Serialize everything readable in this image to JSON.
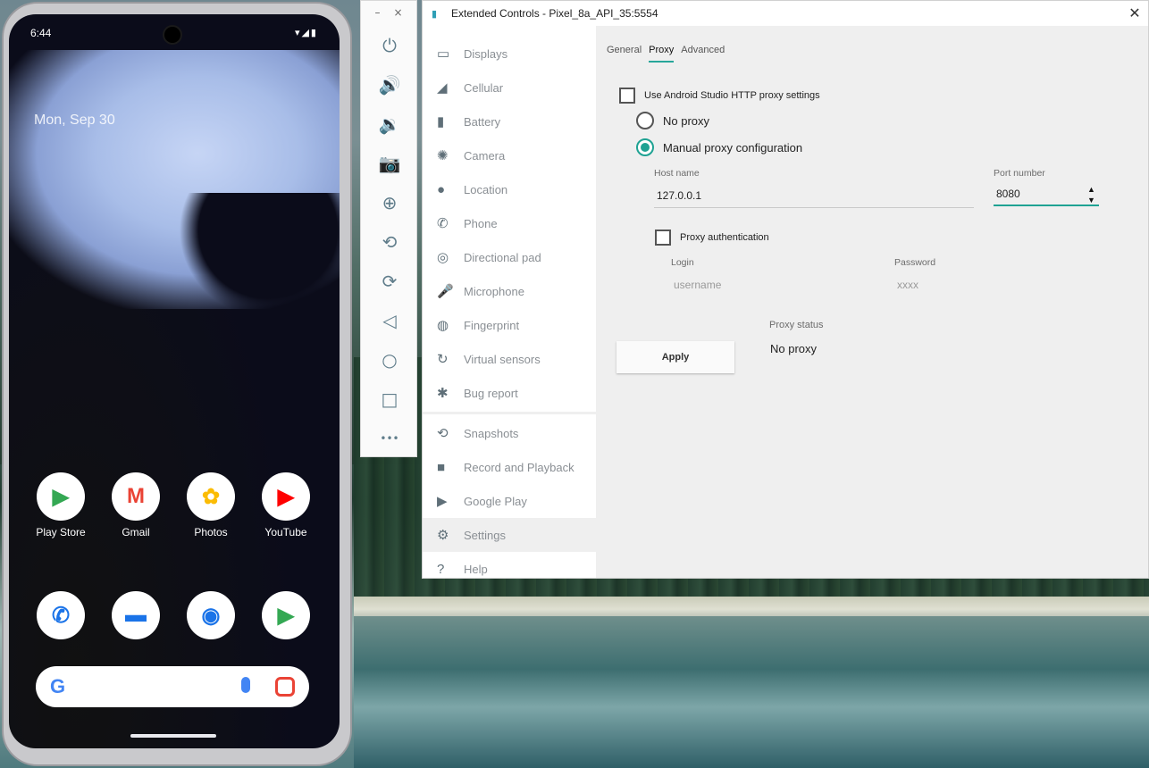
{
  "phone": {
    "time": "6:44",
    "status_icons": "▾◢▮",
    "date": "Mon, Sep 30",
    "apps_row1": [
      {
        "label": "Play Store",
        "icon": "play-store-icon",
        "glyph": "▶",
        "color": "#34a853"
      },
      {
        "label": "Gmail",
        "icon": "gmail-icon",
        "glyph": "M",
        "color": "#ea4335"
      },
      {
        "label": "Photos",
        "icon": "photos-icon",
        "glyph": "✿",
        "color": "#fbbc04"
      },
      {
        "label": "YouTube",
        "icon": "youtube-icon",
        "glyph": "▶",
        "color": "#ff0000"
      }
    ],
    "apps_row2": [
      {
        "icon": "phone-icon",
        "glyph": "✆",
        "color": "#1a73e8"
      },
      {
        "icon": "messages-icon",
        "glyph": "▬",
        "color": "#1a73e8"
      },
      {
        "icon": "chrome-icon",
        "glyph": "◉",
        "color": "#1a73e8"
      },
      {
        "icon": "play-store-2-icon",
        "glyph": "▶",
        "color": "#34a853"
      }
    ],
    "search_g": "G"
  },
  "toolbar": {
    "minimize": "–",
    "close": "×",
    "buttons": [
      {
        "name": "power-icon",
        "glyph": "⏻"
      },
      {
        "name": "volume-up-icon",
        "glyph": "🔊"
      },
      {
        "name": "volume-down-icon",
        "glyph": "🔉"
      },
      {
        "name": "camera-icon",
        "glyph": "📷"
      },
      {
        "name": "zoom-icon",
        "glyph": "⊕"
      },
      {
        "name": "rotate-left-icon",
        "glyph": "⟲"
      },
      {
        "name": "rotate-right-icon",
        "glyph": "⟳"
      },
      {
        "name": "back-icon",
        "glyph": "◁"
      },
      {
        "name": "home-icon",
        "glyph": "○"
      },
      {
        "name": "overview-icon",
        "glyph": "□"
      },
      {
        "name": "more-icon",
        "glyph": "•••"
      }
    ]
  },
  "window": {
    "title": "Extended Controls - Pixel_8a_API_35:5554",
    "close": "✕"
  },
  "nav": {
    "items": [
      {
        "label": "Displays",
        "glyph": "▭"
      },
      {
        "label": "Cellular",
        "glyph": "◢"
      },
      {
        "label": "Battery",
        "glyph": "▮"
      },
      {
        "label": "Camera",
        "glyph": "✺"
      },
      {
        "label": "Location",
        "glyph": "●"
      },
      {
        "label": "Phone",
        "glyph": "✆"
      },
      {
        "label": "Directional pad",
        "glyph": "◎"
      },
      {
        "label": "Microphone",
        "glyph": "🎤"
      },
      {
        "label": "Fingerprint",
        "glyph": "◍"
      },
      {
        "label": "Virtual sensors",
        "glyph": "↻"
      },
      {
        "label": "Bug report",
        "glyph": "✱"
      }
    ],
    "items2": [
      {
        "label": "Snapshots",
        "glyph": "⟲"
      },
      {
        "label": "Record and Playback",
        "glyph": "■"
      },
      {
        "label": "Google Play",
        "glyph": "▶"
      },
      {
        "label": "Settings",
        "glyph": "⚙",
        "active": true
      },
      {
        "label": "Help",
        "glyph": "?"
      }
    ]
  },
  "tabs": [
    "General",
    "Proxy",
    "Advanced"
  ],
  "proxy": {
    "use_studio": "Use Android Studio HTTP proxy settings",
    "no_proxy": "No proxy",
    "manual": "Manual proxy configuration",
    "host_label": "Host name",
    "host_value": "127.0.0.1",
    "port_label": "Port number",
    "port_value": "8080",
    "auth_label": "Proxy authentication",
    "login_label": "Login",
    "login_placeholder": "username",
    "password_label": "Password",
    "password_placeholder": "xxxx",
    "apply": "Apply",
    "status_label": "Proxy status",
    "status_value": "No proxy"
  }
}
